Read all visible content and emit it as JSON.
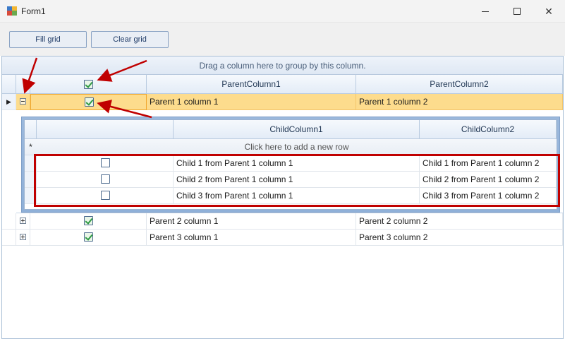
{
  "window": {
    "title": "Form1"
  },
  "toolbar": {
    "fill_label": "Fill grid",
    "clear_label": "Clear grid"
  },
  "grid": {
    "group_panel_text": "Drag a column here to group by this column.",
    "columns": [
      "",
      "ParentColumn1",
      "ParentColumn2"
    ],
    "header_checkbox_checked": true,
    "rows": [
      {
        "checked": true,
        "col1": "Parent 1 column 1",
        "col2": "Parent 1 column 2",
        "expanded": true,
        "selected": true
      },
      {
        "checked": true,
        "col1": "Parent 2 column 1",
        "col2": "Parent 2 column 2",
        "expanded": false,
        "selected": false
      },
      {
        "checked": true,
        "col1": "Parent 3 column 1",
        "col2": "Parent 3 column 2",
        "expanded": false,
        "selected": false
      }
    ],
    "child": {
      "columns": [
        "",
        "ChildColumn1",
        "ChildColumn2"
      ],
      "new_row_marker": "*",
      "new_row_text": "Click here to add a new row",
      "rows": [
        {
          "checked": false,
          "col1": "Child 1 from Parent 1 column 1",
          "col2": "Child 1 from Parent 1 column 2"
        },
        {
          "checked": false,
          "col1": "Child 2 from Parent 1 column 1",
          "col2": "Child 2 from Parent 1 column 2"
        },
        {
          "checked": false,
          "col1": "Child 3 from Parent 1 column 1",
          "col2": "Child 3 from Parent 1 column 2"
        }
      ]
    }
  },
  "colors": {
    "annotation_red": "#c00000",
    "selection": "#fddc8d",
    "check_green": "#2f9a44"
  }
}
